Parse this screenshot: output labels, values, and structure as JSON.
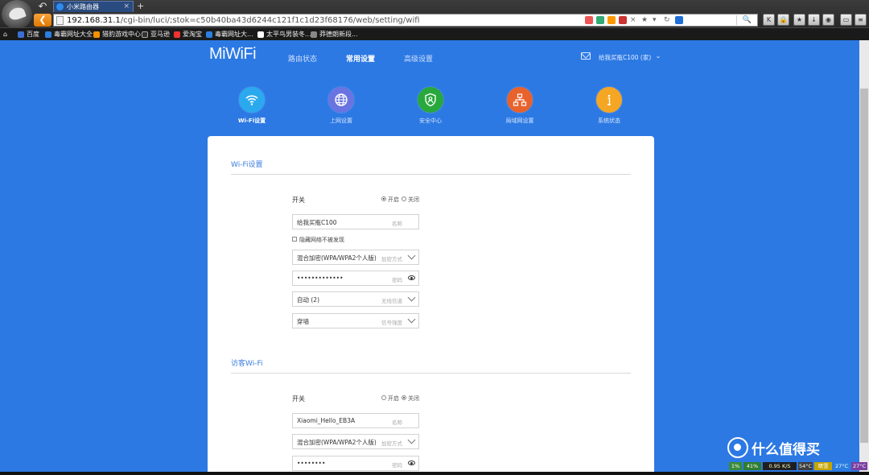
{
  "browser": {
    "tab_title": "小米路由器",
    "new_tab": "+",
    "url_host": "192.168.31.1",
    "url_path": "/cgi-bin/luci/;stok=c50b40ba43d6244c121f1c1d23f68176/web/setting/wifi",
    "bookmarks": [
      "百度",
      "毒霸网址大全",
      "猎豹游戏中心",
      "亚马逊",
      "爱淘宝",
      "毒霸网址大...",
      "太平鸟男装冬...",
      "莽德朗新段..."
    ]
  },
  "header": {
    "logo": "MiWiFi",
    "nav": [
      "路由状态",
      "常用设置",
      "高级设置"
    ],
    "nav_active": 1,
    "user": "给我买瓶C100 (家)"
  },
  "categories": [
    {
      "label": "Wi-Fi设置",
      "color": "#2ba9ef",
      "icon": "wifi-icon"
    },
    {
      "label": "上网设置",
      "color": "#6a74e0",
      "icon": "globe-icon"
    },
    {
      "label": "安全中心",
      "color": "#29a83c",
      "icon": "shield-icon"
    },
    {
      "label": "局域网设置",
      "color": "#e8622c",
      "icon": "network-icon"
    },
    {
      "label": "系统状态",
      "color": "#f5a623",
      "icon": "info-icon"
    }
  ],
  "wifi": {
    "title": "Wi-Fi设置",
    "switch_label": "开关",
    "on_label": "开启",
    "off_label": "关闭",
    "ssid_value": "给我买瓶C100",
    "ssid_placeholder": "名称",
    "hidden_label": "隐藏网络不被发现",
    "encryption_value": "混合加密(WPA/WPA2个人版)",
    "encryption_placeholder": "加密方式",
    "password_value": "•••••••••••••",
    "password_placeholder": "密码",
    "channel_value": "自动 (2)",
    "channel_placeholder": "无线信道",
    "strength_value": "穿墙",
    "strength_placeholder": "信号强度"
  },
  "guest": {
    "title": "访客Wi-Fi",
    "switch_label": "开关",
    "on_label": "开启",
    "off_label": "关闭",
    "ssid_value": "Xiaomi_Hello_EB3A",
    "ssid_placeholder": "名称",
    "encryption_value": "混合加密(WPA/WPA2个人版)",
    "encryption_placeholder": "加密方式",
    "password_value": "••••••••",
    "password_placeholder": "密码"
  },
  "tray": {
    "cpu": "1%",
    "mem": "41%",
    "net": "0.95 K/S",
    "temp1": "54°C",
    "weather": "晴雪",
    "temp2": "27°C",
    "temp3": "27°C"
  },
  "watermark": "什么值得买",
  "colors": {
    "page_bg": "#2c79e4",
    "accent": "#3b7ddd"
  }
}
